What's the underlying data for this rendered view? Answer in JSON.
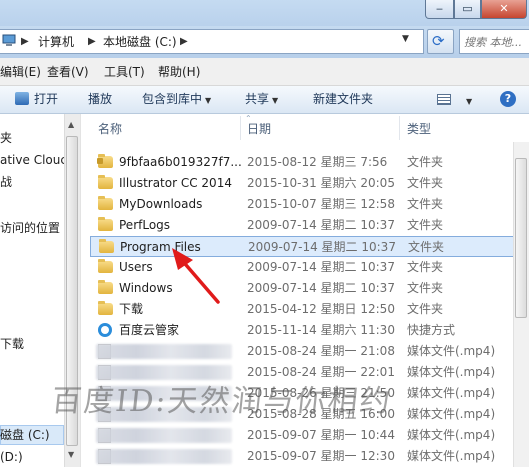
{
  "window": {
    "minimize_symbol": "‒",
    "maximize_symbol": "▭",
    "close_symbol": "✕"
  },
  "address": {
    "crumbs": [
      "计算机",
      "本地磁盘 (C:)"
    ],
    "separator": "▶",
    "search_placeholder": "搜索 本地..."
  },
  "menu": {
    "items": [
      "编辑(E)",
      "查看(V)",
      "工具(T)",
      "帮助(H)"
    ]
  },
  "toolbar": {
    "open": "打开",
    "play": "播放",
    "include_in_library": "包含到库中",
    "share": "共享",
    "new_folder": "新建文件夹",
    "dropdown_arrow": "▼",
    "help": "?"
  },
  "nav": {
    "items": [
      "夹",
      "ative Clouc",
      "战",
      "访问的位置",
      "",
      "",
      "",
      "下载",
      "",
      "",
      "",
      "磁盘 (C:)",
      "(D:)"
    ],
    "selected_index": 11
  },
  "columns": {
    "name": "名称",
    "date": "日期",
    "type": "类型"
  },
  "files": [
    {
      "name": "9fbfaa6b019327f7...",
      "date": "2015-08-12 星期三 7:56",
      "type": "文件夹",
      "icon": "lock-folder-icon"
    },
    {
      "name": "Illustrator CC 2014",
      "date": "2015-10-31 星期六 20:05",
      "type": "文件夹",
      "icon": "folder-icon"
    },
    {
      "name": "MyDownloads",
      "date": "2015-10-07 星期三 12:58",
      "type": "文件夹",
      "icon": "folder-icon"
    },
    {
      "name": "PerfLogs",
      "date": "2009-07-14 星期二 10:37",
      "type": "文件夹",
      "icon": "folder-icon"
    },
    {
      "name": "Program Files",
      "date": "2009-07-14 星期二 10:37",
      "type": "文件夹",
      "icon": "folder-icon",
      "selected": true
    },
    {
      "name": "Users",
      "date": "2009-07-14 星期二 10:37",
      "type": "文件夹",
      "icon": "folder-icon"
    },
    {
      "name": "Windows",
      "date": "2009-07-14 星期二 10:37",
      "type": "文件夹",
      "icon": "folder-icon"
    },
    {
      "name": "下载",
      "date": "2015-04-12 星期日 12:50",
      "type": "文件夹",
      "icon": "folder-icon"
    },
    {
      "name": "百度云管家",
      "date": "2015-11-14 星期六 11:30",
      "type": "快捷方式",
      "icon": "shortcut-icon"
    },
    {
      "name": "",
      "date": "2015-08-24 星期一 21:08",
      "type": "媒体文件(.mp4)",
      "icon": "media-file-icon",
      "blurred": true
    },
    {
      "name": "",
      "date": "2015-08-24 星期一 22:01",
      "type": "媒体文件(.mp4)",
      "icon": "media-file-icon",
      "blurred": true
    },
    {
      "name": "",
      "date": "2015-08-26 星期三 21:50",
      "type": "媒体文件(.mp4)",
      "icon": "media-file-icon",
      "blurred": true
    },
    {
      "name": "",
      "date": "2015-08-28 星期五 16:00",
      "type": "媒体文件(.mp4)",
      "icon": "media-file-icon",
      "blurred": true
    },
    {
      "name": "",
      "date": "2015-09-07 星期一 10:44",
      "type": "媒体文件(.mp4)",
      "icon": "media-file-icon",
      "blurred": true
    },
    {
      "name": "",
      "date": "2015-09-07 星期一 12:30",
      "type": "媒体文件(.mp4)",
      "icon": "media-file-icon",
      "blurred": true
    }
  ],
  "watermark": "百度ID:天然润与你相约",
  "colors": {
    "selection": "#dcebfc",
    "annotation_arrow": "#e01b1b"
  }
}
